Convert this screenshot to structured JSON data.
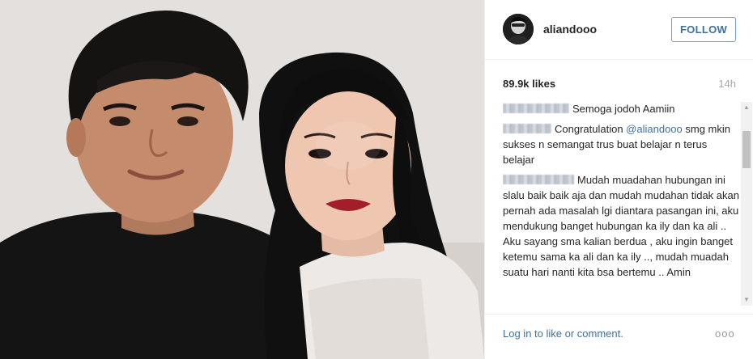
{
  "post": {
    "username": "aliandooo",
    "follow_label": "FOLLOW",
    "likes": "89.9k likes",
    "time": "14h"
  },
  "comments": [
    {
      "text": "Semoga jodoh Aamiin"
    },
    {
      "text": "Congratulation ",
      "mention": "@aliandooo",
      "text2": " smg mkin sukses n semangat trus buat belajar n terus belajar"
    },
    {
      "text": "Mudah muadahan hubungan ini slalu baik baik aja dan mudah mudahan tidak akan pernah ada masalah lgi diantara pasangan ini, aku mendukung banget hubungan ka ily dan ka ali .. Aku sayang sma kalian berdua , aku ingin banget ketemu sama ka ali dan ka ily .., mudah muadah suatu hari nanti kita bsa bertemu .. Amin"
    }
  ],
  "footer": {
    "login_text": "Log in to like or comment.",
    "more_label": "ooo"
  },
  "colors": {
    "link_blue": "#3f729b",
    "follow_border": "#70a2c9",
    "muted_gray": "#a5a7aa"
  },
  "icons": {
    "more": "more-options-icon",
    "scroll_up": "scroll-up-arrow-icon",
    "scroll_down": "scroll-down-arrow-icon"
  }
}
